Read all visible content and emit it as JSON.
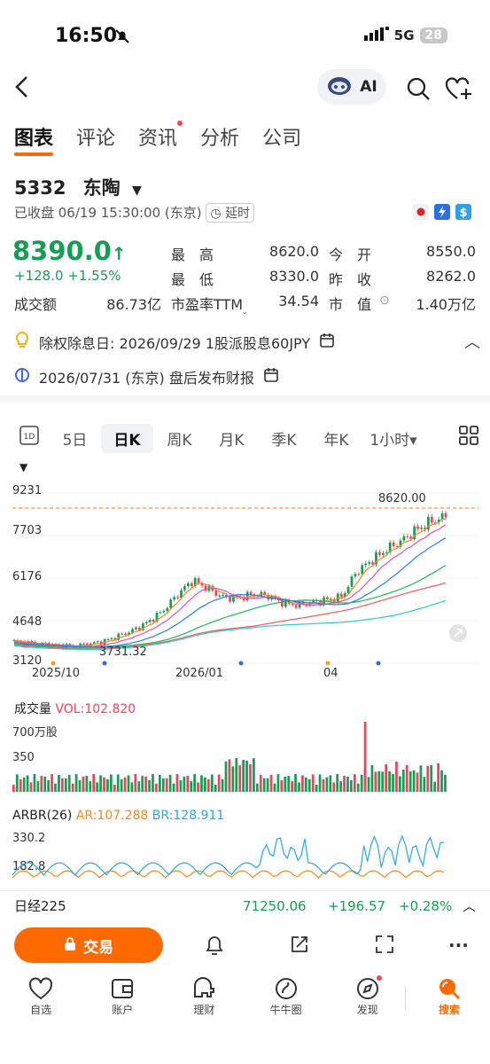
{
  "status": {
    "time": "16:50",
    "network": "5G",
    "battery": "28"
  },
  "nav": {
    "ai_label": "AI"
  },
  "tabs": [
    "图表",
    "评论",
    "资讯",
    "分析",
    "公司"
  ],
  "stock": {
    "code": "5332",
    "name": "东陶",
    "state": "已收盘 06/19 15:30:00 (东京)",
    "delay": "延时",
    "price": "8390.0",
    "change": "+128.0 +1.55%",
    "stats": {
      "high_label": "最　高",
      "high": "8620.0",
      "open_label": "今　开",
      "open": "8550.0",
      "low_label": "最　低",
      "low": "8330.0",
      "prev_label": "昨　收",
      "prev": "8262.0",
      "turnover_label": "成交额",
      "turnover": "86.73亿",
      "pe_label": "市盈率TTM",
      "pe": "34.54",
      "mcap_label": "市　值",
      "mcap": "1.40万亿"
    }
  },
  "events": {
    "dividend": "除权除息日: 2026/09/29 1股派股息60JPY",
    "earnings": "2026/07/31 (东京) 盘后发布财报"
  },
  "periods": [
    "5日",
    "日K",
    "周K",
    "月K",
    "季K",
    "年K",
    "1小时"
  ],
  "chart_data": [
    {
      "type": "candlestick",
      "ylim": [
        3120,
        9231
      ],
      "y_ticks": [
        "9231",
        "7703",
        "6176",
        "4648",
        "3120"
      ],
      "x_ticks": [
        "2025/10",
        "2026/01",
        "04"
      ],
      "annotations": {
        "high_marker": "8620.00",
        "low_marker": "3731.32"
      },
      "current_price": 8390.0,
      "approx_close_trend": [
        3900,
        3850,
        3800,
        3760,
        3740,
        3800,
        3900,
        4100,
        4300,
        4600,
        5000,
        5600,
        6100,
        5800,
        5500,
        5450,
        5600,
        5550,
        5300,
        5200,
        5300,
        5400,
        5500,
        6400,
        6800,
        7200,
        7500,
        7900,
        8200,
        8390
      ]
    },
    {
      "type": "bar",
      "title": "成交量",
      "indicator": "VOL:102.820",
      "y_ticks": [
        "700万股",
        "350"
      ]
    },
    {
      "type": "line",
      "title": "ARBR(26)",
      "series": [
        {
          "name": "AR:107.288"
        },
        {
          "name": "BR:128.911"
        }
      ],
      "y_ticks": [
        "330.2",
        "182.8"
      ]
    }
  ],
  "index": {
    "name": "日经225",
    "value": "71250.06",
    "change": "+196.57",
    "pct": "+0.28%"
  },
  "actions": {
    "trade": "交易"
  },
  "bottom_nav": [
    "自选",
    "账户",
    "理财",
    "牛牛圈",
    "发现",
    "搜索"
  ],
  "colors": {
    "up": "#1a9b56",
    "down": "#e8475b",
    "accent": "#ff6a00"
  }
}
